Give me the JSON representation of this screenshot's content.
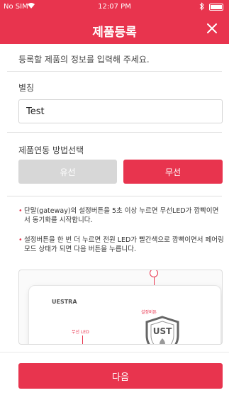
{
  "status_bar": {
    "carrier": "No SIM",
    "time": "12:07 PM"
  },
  "nav": {
    "title": "제품등록",
    "close_icon": "close-icon"
  },
  "instruction": "등록할 제품의 정보를 입력해 주세요.",
  "nickname": {
    "label": "별칭",
    "value": "Test"
  },
  "connection": {
    "label": "제품연동 방법선택",
    "wired_label": "유선",
    "wireless_label": "무선",
    "selected": "무선"
  },
  "notes": [
    "단말(gateway)의 설정버튼을 5초 이상 누르면 무선LED가 깜빡이면서 동기화를 시작합니다.",
    "설정버튼을 한 번 더 누르면 전원 LED가 빨간색으로 깜빡이면서 페어링모드 상태가 되면 다음 버튼을 누릅니다."
  ],
  "illustration": {
    "brand": "UESTRA",
    "setting_button_label": "설정버튼",
    "wireless_led_label": "무선 LED",
    "shield_text": "UST"
  },
  "next_button": "다음",
  "colors": {
    "accent": "#e8344e",
    "disabled": "#d7d7d7"
  }
}
